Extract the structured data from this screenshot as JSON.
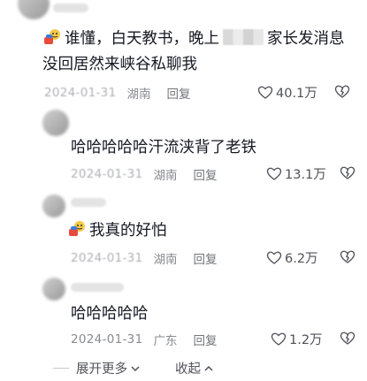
{
  "comments": [
    {
      "text_prefix": "谁懂，白天教书，晚上",
      "text_suffix": "家长发消息",
      "text_line2": "没回居然来峡谷私聊我",
      "date": "2024-01-31",
      "location": "湖南",
      "reply_label": "回复",
      "likes": "40.1万",
      "emoji": "hand-emoji-icon"
    },
    {
      "text": "哈哈哈哈哈汗流浃背了老铁",
      "date": "2024-01-31",
      "location": "湖南",
      "reply_label": "回复",
      "likes": "13.1万"
    },
    {
      "text": "我真的好怕",
      "date": "2024-01-31",
      "location": "湖南",
      "reply_label": "回复",
      "likes": "6.2万",
      "emoji": "hand-emoji-icon"
    },
    {
      "text": "哈哈哈哈哈",
      "date": "2024-01-31",
      "location": "广东",
      "reply_label": "回复",
      "likes": "1.2万"
    }
  ],
  "footer": {
    "expand_label": "展开更多",
    "collapse_label": "收起"
  },
  "colors": {
    "text": "#161823",
    "meta": "#8a8b91",
    "like": "#505159"
  }
}
